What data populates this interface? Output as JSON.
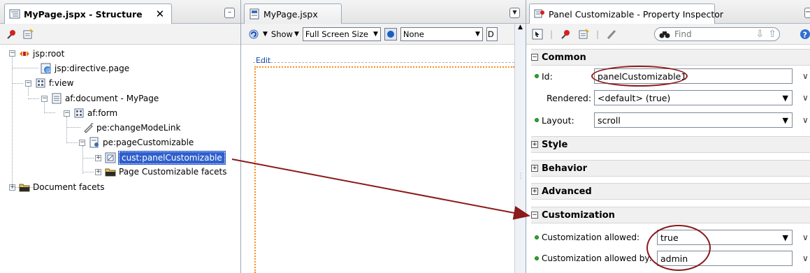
{
  "structure": {
    "tab_title": "MyPage.jspx - Structure",
    "close_glyph": "✕",
    "minimize_glyph": "–",
    "tree": [
      {
        "label": "jsp:root",
        "icon": "jsp-root-icon"
      },
      {
        "label": "jsp:directive.page",
        "icon": "directive-icon"
      },
      {
        "label": "f:view",
        "icon": "view-icon"
      },
      {
        "label": "af:document - MyPage",
        "icon": "document-icon"
      },
      {
        "label": "af:form",
        "icon": "form-icon"
      },
      {
        "label": "pe:changeModeLink",
        "icon": "link-icon"
      },
      {
        "label": "pe:pageCustomizable",
        "icon": "page-customizable-icon"
      },
      {
        "label": "cust:panelCustomizable",
        "icon": "panel-customizable-icon",
        "selected": true
      },
      {
        "label": "Page Customizable facets",
        "icon": "folder-icon"
      },
      {
        "label": "Document facets",
        "icon": "folder-icon"
      }
    ]
  },
  "editor": {
    "tab_title": "MyPage.jspx",
    "show_label": "Show",
    "size_combo": "Full Screen Size",
    "skin_combo": "None",
    "extra_combo": "D",
    "edit_label": "Edit"
  },
  "inspector": {
    "tab_title": "Panel Customizable - Property Inspector",
    "find_placeholder": "Find",
    "sections": {
      "common": "Common",
      "style": "Style",
      "behavior": "Behavior",
      "advanced": "Advanced",
      "customization": "Customization"
    },
    "properties": {
      "id_label": "Id:",
      "id_value": "panelCustomizable1",
      "rendered_label": "Rendered:",
      "rendered_value": "<default> (true)",
      "layout_label": "Layout:",
      "layout_value": "scroll",
      "cust_allowed_label": "Customization allowed:",
      "cust_allowed_value": "true",
      "cust_allowed_by_label": "Customization allowed by:",
      "cust_allowed_by_value": "admin"
    }
  },
  "colors": {
    "selection": "#2f5fcc",
    "annotation": "#8b1a1a",
    "required_dot": "#2aa52a",
    "design_outline": "#ff8c1a"
  }
}
